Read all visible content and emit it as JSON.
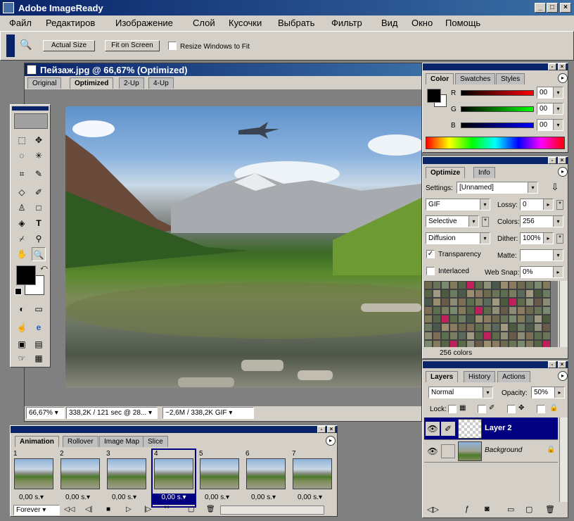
{
  "app": {
    "title": "Adobe ImageReady"
  },
  "menu": [
    "Файл",
    "Редактиров",
    "Изображение",
    "Слой",
    "Кусочки",
    "Выбрать",
    "Фильтр",
    "Вид",
    "Окно",
    "Помощь"
  ],
  "options_bar": {
    "actual_size": "Actual Size",
    "fit_on_screen": "Fit on Screen",
    "resize_windows": "Resize Windows to Fit"
  },
  "document": {
    "title": "Пейзаж.jpg @ 66,67% (Optimized)",
    "tabs": [
      "Original",
      "Optimized",
      "2-Up",
      "4-Up"
    ],
    "status": {
      "zoom": "66,67%",
      "size": "338,2K / 121 sec @ 28...",
      "gif": "~2,6M / 338,2K GIF"
    }
  },
  "color_panel": {
    "tabs": [
      "Color",
      "Swatches",
      "Styles"
    ],
    "channels": [
      {
        "name": "R",
        "value": "00"
      },
      {
        "name": "G",
        "value": "00"
      },
      {
        "name": "B",
        "value": "00"
      }
    ]
  },
  "optimize_panel": {
    "tabs": [
      "Optimize",
      "Info"
    ],
    "settings_label": "Settings:",
    "settings_value": "[Unnamed]",
    "format": "GIF",
    "lossy_label": "Lossy:",
    "lossy_value": "0",
    "palette": "Selective",
    "colors_label": "Colors:",
    "colors_value": "256",
    "dither_method": "Diffusion",
    "dither_label": "Dither:",
    "dither_value": "100%",
    "transparency": "Transparency",
    "matte_label": "Matte:",
    "interlaced": "Interlaced",
    "websnap_label": "Web Snap:",
    "websnap_value": "0%",
    "color_count": "256 colors"
  },
  "layers_panel": {
    "tabs": [
      "Layers",
      "History",
      "Actions"
    ],
    "blend_mode": "Normal",
    "opacity_label": "Opacity:",
    "opacity_value": "50%",
    "lock_label": "Lock:",
    "layers": [
      {
        "name": "Layer 2"
      },
      {
        "name": "Background"
      }
    ]
  },
  "animation_panel": {
    "tabs": [
      "Animation",
      "Rollover",
      "Image Map",
      "Slice"
    ],
    "frames": [
      {
        "num": "1",
        "delay": "0,00 s."
      },
      {
        "num": "2",
        "delay": "0,00 s."
      },
      {
        "num": "3",
        "delay": "0,00 s."
      },
      {
        "num": "4",
        "delay": "0,00 s."
      },
      {
        "num": "5",
        "delay": "0,00 s."
      },
      {
        "num": "6",
        "delay": "0,00 s."
      },
      {
        "num": "7",
        "delay": "0,00 s."
      }
    ],
    "loop": "Forever"
  },
  "colors": {
    "accent": "#0a246a",
    "face": "#d4d0c8",
    "selection": "#000080"
  }
}
